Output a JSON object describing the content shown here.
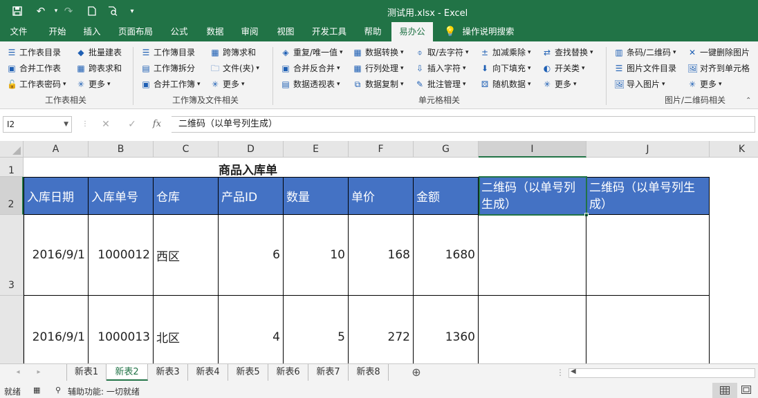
{
  "window": {
    "title": "测试用.xlsx  -  Excel"
  },
  "quick_access": [
    "save-icon",
    "undo-icon",
    "redo-icon",
    "new-file-icon",
    "print-preview-icon",
    "customize-icon"
  ],
  "tabs": [
    "文件",
    "开始",
    "插入",
    "页面布局",
    "公式",
    "数据",
    "审阅",
    "视图",
    "开发工具",
    "帮助",
    "易办公",
    "操作说明搜索"
  ],
  "ribbon": {
    "g1": {
      "items": [
        "工作表目录",
        "批量建表",
        "合并工作表",
        "跨表求和",
        "工作表密码",
        "更多"
      ],
      "label": "工作表相关"
    },
    "g2": {
      "items": [
        "工作簿目录",
        "跨簿求和",
        "工作簿拆分",
        "文件(夹)",
        "合并工作簿",
        "更多"
      ],
      "label": "工作簿及文件相关"
    },
    "g3": {
      "items": [
        "重复/唯一值",
        "数据转换",
        "取/去字符",
        "加减乘除",
        "查找替换",
        "合并反合并",
        "行列处理",
        "插入字符",
        "向下填充",
        "开关类",
        "数据透视表",
        "数据复制",
        "批注管理",
        "随机数据",
        "更多"
      ],
      "label": "单元格相关"
    },
    "g4": {
      "items": [
        "条码/二维码",
        "一键删除图片",
        "图片文件目录",
        "对齐到单元格",
        "导入图片",
        "更多"
      ],
      "label": "图片/二维码相关"
    }
  },
  "formula_bar": {
    "name_box": "I2",
    "cancel": "✕",
    "enter": "✓",
    "fx": "fx",
    "content": "二维码（以单号列生成）"
  },
  "columns": [
    "A",
    "B",
    "C",
    "D",
    "E",
    "F",
    "G",
    "I",
    "J",
    "K"
  ],
  "rows": [
    "1",
    "2",
    "3"
  ],
  "sheet": {
    "title": "商品入库单",
    "headers": [
      "入库日期",
      "入库单号",
      "仓库",
      "产品ID",
      "数量",
      "单价",
      "金额",
      "二维码（以单号列生成）",
      "二维码（以单号列生成）"
    ],
    "data": [
      [
        "2016/9/1",
        "1000012",
        "西区",
        "6",
        "10",
        "168",
        "1680"
      ],
      [
        "2016/9/1",
        "1000013",
        "北区",
        "4",
        "5",
        "272",
        "1360"
      ]
    ]
  },
  "sheet_tabs": [
    "新表1",
    "新表2",
    "新表3",
    "新表4",
    "新表5",
    "新表6",
    "新表7",
    "新表8"
  ],
  "active_sheet": "新表2",
  "status": {
    "ready": "就绪",
    "accessibility": "辅助功能: 一切就绪"
  },
  "colors": {
    "brand": "#217346",
    "header_fill": "#4472c4"
  }
}
